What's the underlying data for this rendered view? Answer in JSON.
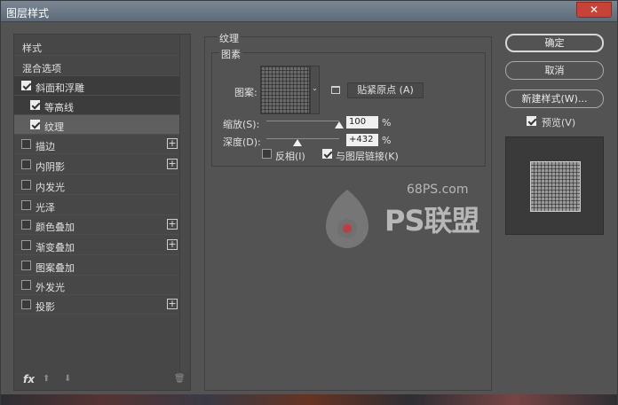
{
  "window": {
    "title": "图层样式",
    "close_glyph": "✕"
  },
  "sidebar": {
    "header": "样式",
    "items": [
      {
        "label": "混合选项",
        "checkbox": false,
        "checked": false,
        "plus": false
      },
      {
        "label": "斜面和浮雕",
        "checkbox": true,
        "checked": true,
        "plus": false
      },
      {
        "label": "等高线",
        "checkbox": true,
        "checked": true,
        "plus": false
      },
      {
        "label": "纹理",
        "checkbox": true,
        "checked": true,
        "plus": false
      },
      {
        "label": "描边",
        "checkbox": true,
        "checked": false,
        "plus": true
      },
      {
        "label": "内阴影",
        "checkbox": true,
        "checked": false,
        "plus": true
      },
      {
        "label": "内发光",
        "checkbox": true,
        "checked": false,
        "plus": false
      },
      {
        "label": "光泽",
        "checkbox": true,
        "checked": false,
        "plus": false
      },
      {
        "label": "颜色叠加",
        "checkbox": true,
        "checked": false,
        "plus": true
      },
      {
        "label": "渐变叠加",
        "checkbox": true,
        "checked": false,
        "plus": true
      },
      {
        "label": "图案叠加",
        "checkbox": true,
        "checked": false,
        "plus": false
      },
      {
        "label": "外发光",
        "checkbox": true,
        "checked": false,
        "plus": false
      },
      {
        "label": "投影",
        "checkbox": true,
        "checked": false,
        "plus": true
      }
    ],
    "fx_label": "fx",
    "plus_glyph": "+",
    "up_glyph": "⬆",
    "down_glyph": "⬇",
    "trash_glyph": "🗑"
  },
  "texture": {
    "section_title": "纹理",
    "subgroup_title": "图素",
    "pattern_label": "图案:",
    "dropdown_glyph": "⌄",
    "snap_button": "贴紧原点 (A)",
    "scale_label": "缩放(S):",
    "scale_value": "100",
    "scale_level": 1.0,
    "depth_label": "深度(D):",
    "depth_value": "+432",
    "depth_level": 0.432,
    "percent": "%",
    "invert_label": "反相(I)",
    "invert_checked": false,
    "link_label": "与图层链接(K)",
    "link_checked": true
  },
  "buttons": {
    "ok": "确定",
    "cancel": "取消",
    "new_style": "新建样式(W)...",
    "preview_label": "预览(V)",
    "preview_checked": true
  },
  "watermark": {
    "site": "68PS.com",
    "brand": "PS联盟"
  }
}
